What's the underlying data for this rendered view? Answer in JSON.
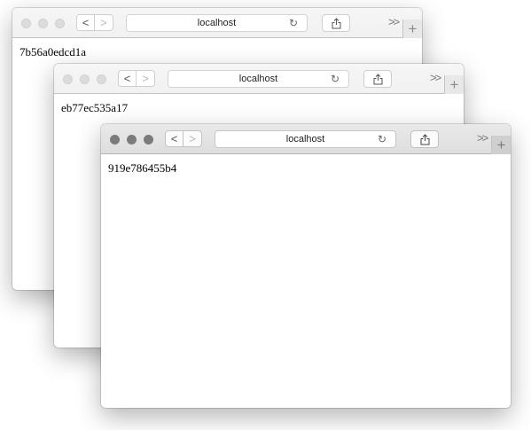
{
  "windows": [
    {
      "address": "localhost",
      "page_text": "7b56a0edcd1a",
      "back_label": "<",
      "forward_label": ">",
      "overflow_label": ">>",
      "new_tab_label": "+",
      "reload_glyph": "↻"
    },
    {
      "address": "localhost",
      "page_text": "eb77ec535a17",
      "back_label": "<",
      "forward_label": ">",
      "overflow_label": ">>",
      "new_tab_label": "+",
      "reload_glyph": "↻"
    },
    {
      "address": "localhost",
      "page_text": "919e786455b4",
      "back_label": "<",
      "forward_label": ">",
      "overflow_label": ">>",
      "new_tab_label": "+",
      "reload_glyph": "↻"
    }
  ],
  "icons": {
    "traffic_lights": "traffic-light-icons",
    "back": "chevron-left-icon",
    "forward": "chevron-right-icon",
    "reload": "reload-icon",
    "share": "share-icon",
    "overflow": "double-chevron-icon",
    "new_tab": "plus-icon"
  },
  "colors": {
    "active_traffic_light": "#7b7b7b",
    "inactive_traffic_light": "#dcdcdc"
  }
}
